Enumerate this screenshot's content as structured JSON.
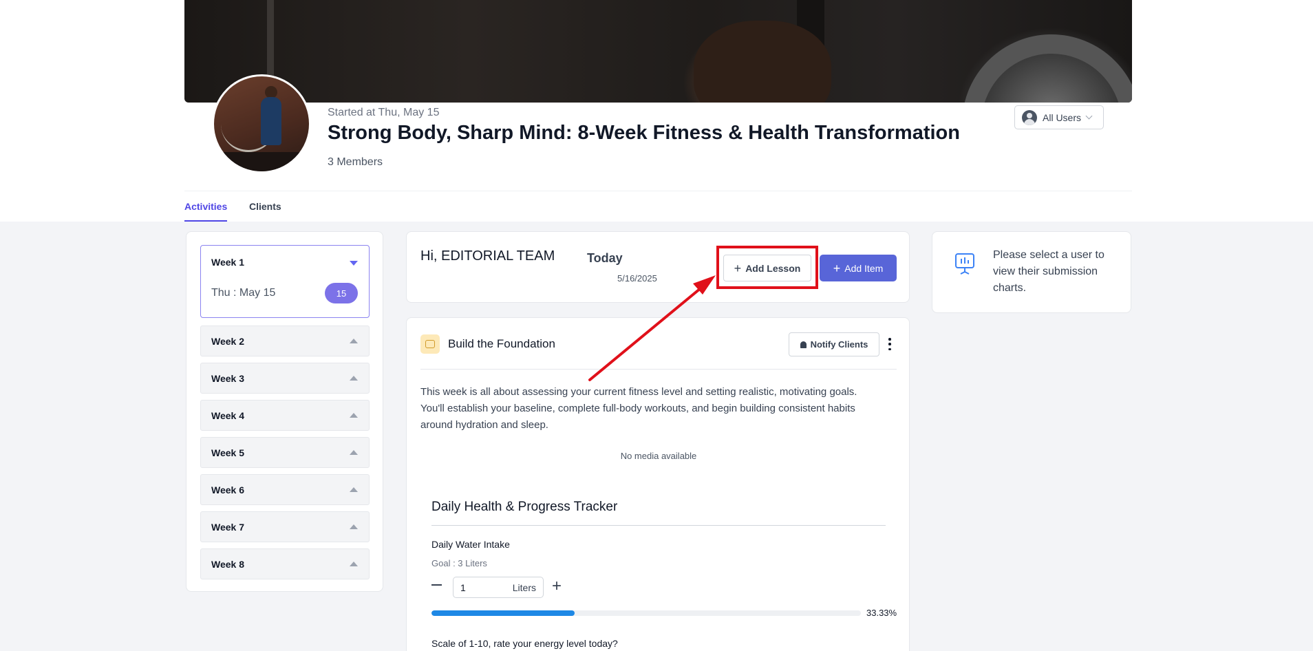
{
  "header": {
    "started": "Started at Thu, May 15",
    "title": "Strong Body, Sharp Mind: 8-Week Fitness & Health Transformation",
    "members": "3 Members",
    "user_filter": "All Users"
  },
  "tabs": [
    {
      "label": "Activities",
      "active": true
    },
    {
      "label": "Clients",
      "active": false
    }
  ],
  "weeks": {
    "open_week": {
      "label": "Week 1",
      "day_label": "Thu : May 15",
      "day_count": "15"
    },
    "collapsed": [
      "Week 2",
      "Week 3",
      "Week 4",
      "Week 5",
      "Week 6",
      "Week 7",
      "Week 8"
    ]
  },
  "top_card": {
    "greeting": "Hi, EDITORIAL TEAM",
    "today_label": "Today",
    "date": "5/16/2025",
    "add_lesson": "Add Lesson",
    "add_item": "Add Item"
  },
  "lesson": {
    "title": "Build the Foundation",
    "notify_label": "Notify Clients",
    "description": "This week is all about assessing your current fitness level and setting realistic, motivating goals. You'll establish your baseline, complete full-body workouts, and begin building consistent habits around hydration and sleep.",
    "no_media": "No media available",
    "tracker": {
      "title": "Daily Health & Progress Tracker",
      "water_label": "Daily Water Intake",
      "goal": "Goal : 3 Liters",
      "value": "1",
      "unit": "Liters",
      "progress_fraction": 0.3333,
      "progress_text": "33.33%",
      "energy_question": "Scale of 1-10, rate your energy level today?"
    }
  },
  "right_card": {
    "message": "Please select a user to view their submission charts."
  },
  "colors": {
    "accent": "#4f46e5",
    "primary_button": "#5865d8",
    "badge": "#7c72e8",
    "progress": "#1e88e5",
    "annotation": "#e0101a"
  },
  "icons": [
    "user-icon",
    "chevron-down-icon",
    "triangle-down-icon",
    "triangle-up-icon",
    "plus-icon",
    "lesson-icon",
    "bell-icon",
    "kebab-icon",
    "minus-icon",
    "monitor-chart-icon"
  ]
}
